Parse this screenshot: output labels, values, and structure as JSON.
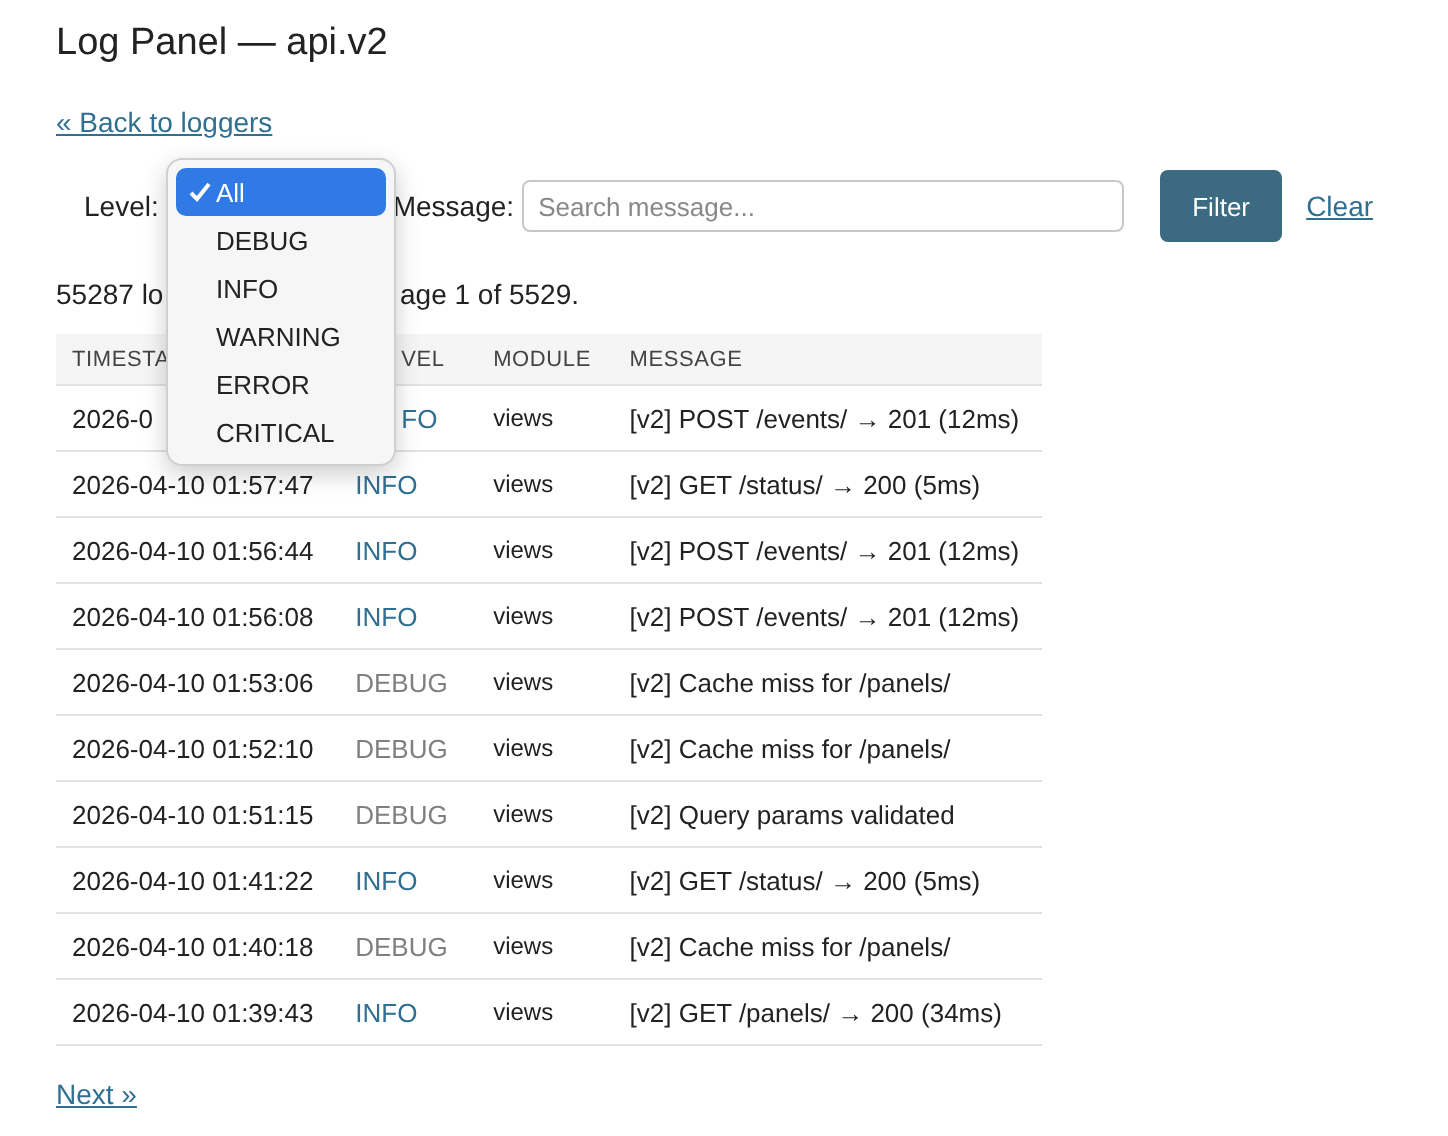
{
  "title": "Log Panel — api.v2",
  "back_link": "« Back to loggers",
  "filter": {
    "level_label": "Level:",
    "message_label": "Message:",
    "message_placeholder": "Search message...",
    "filter_button": "Filter",
    "clear_link": "Clear"
  },
  "level_menu": {
    "items": [
      {
        "label": "All",
        "selected": true
      },
      {
        "label": "DEBUG",
        "selected": false
      },
      {
        "label": "INFO",
        "selected": false
      },
      {
        "label": "WARNING",
        "selected": false
      },
      {
        "label": "ERROR",
        "selected": false
      },
      {
        "label": "CRITICAL",
        "selected": false
      }
    ]
  },
  "summary": {
    "before_menu": "55287 lo",
    "after_menu": "age 1 of 5529."
  },
  "table": {
    "columns": [
      {
        "label": "TIMESTA",
        "covered": false
      },
      {
        "label": "VEL",
        "covered": true
      },
      {
        "label": "MODULE",
        "covered": false
      },
      {
        "label": "MESSAGE",
        "covered": false
      }
    ],
    "rows": [
      {
        "timestamp": "2026-0",
        "level": "FO",
        "color": "#2f6f91",
        "module": "views",
        "message": "[v2] POST /events/ → 201 (12ms)",
        "covered": true
      },
      {
        "timestamp": "2026-04-10 01:57:47",
        "level": "INFO",
        "color": "#2f6f91",
        "module": "views",
        "message": "[v2] GET /status/ → 200 (5ms)",
        "covered": false
      },
      {
        "timestamp": "2026-04-10 01:56:44",
        "level": "INFO",
        "color": "#2f6f91",
        "module": "views",
        "message": "[v2] POST /events/ → 201 (12ms)",
        "covered": false
      },
      {
        "timestamp": "2026-04-10 01:56:08",
        "level": "INFO",
        "color": "#2f6f91",
        "module": "views",
        "message": "[v2] POST /events/ → 201 (12ms)",
        "covered": false
      },
      {
        "timestamp": "2026-04-10 01:53:06",
        "level": "DEBUG",
        "color": "#808080",
        "module": "views",
        "message": "[v2] Cache miss for /panels/",
        "covered": false
      },
      {
        "timestamp": "2026-04-10 01:52:10",
        "level": "DEBUG",
        "color": "#808080",
        "module": "views",
        "message": "[v2] Cache miss for /panels/",
        "covered": false
      },
      {
        "timestamp": "2026-04-10 01:51:15",
        "level": "DEBUG",
        "color": "#808080",
        "module": "views",
        "message": "[v2] Query params validated",
        "covered": false
      },
      {
        "timestamp": "2026-04-10 01:41:22",
        "level": "INFO",
        "color": "#2f6f91",
        "module": "views",
        "message": "[v2] GET /status/ → 200 (5ms)",
        "covered": false
      },
      {
        "timestamp": "2026-04-10 01:40:18",
        "level": "DEBUG",
        "color": "#808080",
        "module": "views",
        "message": "[v2] Cache miss for /panels/",
        "covered": false
      },
      {
        "timestamp": "2026-04-10 01:39:43",
        "level": "INFO",
        "color": "#2f6f91",
        "module": "views",
        "message": "[v2] GET /panels/ → 200 (34ms)",
        "covered": false
      }
    ]
  },
  "next_link": "Next »"
}
